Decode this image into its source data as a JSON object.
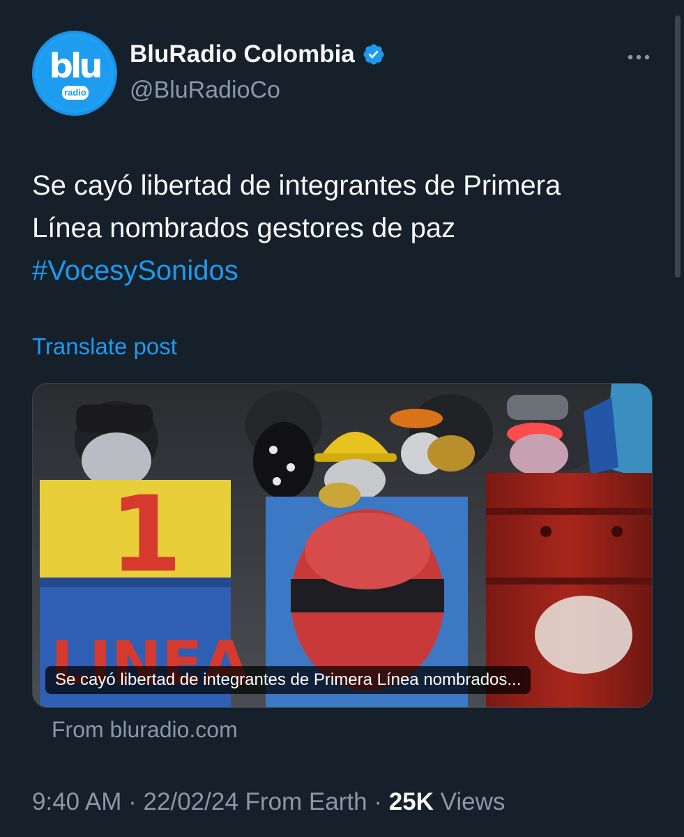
{
  "author": {
    "display_name": "BluRadio Colombia",
    "handle": "@BluRadioCo",
    "avatar_logo_text": "blu",
    "avatar_logo_sub": "radio",
    "verified": true
  },
  "post": {
    "text_line1": "Se cayó libertad de integrantes de Primera",
    "text_line2": "Línea nombrados gestores de paz",
    "hashtag": "#VocesySonidos",
    "translate_label": "Translate post"
  },
  "link_card": {
    "caption": "Se cayó libertad de integrantes de Primera Línea nombrados...",
    "source": "From bluradio.com",
    "image_barrel_text_1": "1",
    "image_barrel_text_2": "LINEA"
  },
  "meta": {
    "time": "9:40 AM",
    "separator": "·",
    "date": "22/02/24",
    "location": "From Earth",
    "views_count": "25K",
    "views_label": "Views"
  },
  "colors": {
    "background": "#15202b",
    "accent": "#1d9bf0",
    "secondary_text": "#8b98a5",
    "primary_text": "#f7f9f9"
  },
  "icons": [
    "verified-badge-icon",
    "more-options-icon"
  ]
}
